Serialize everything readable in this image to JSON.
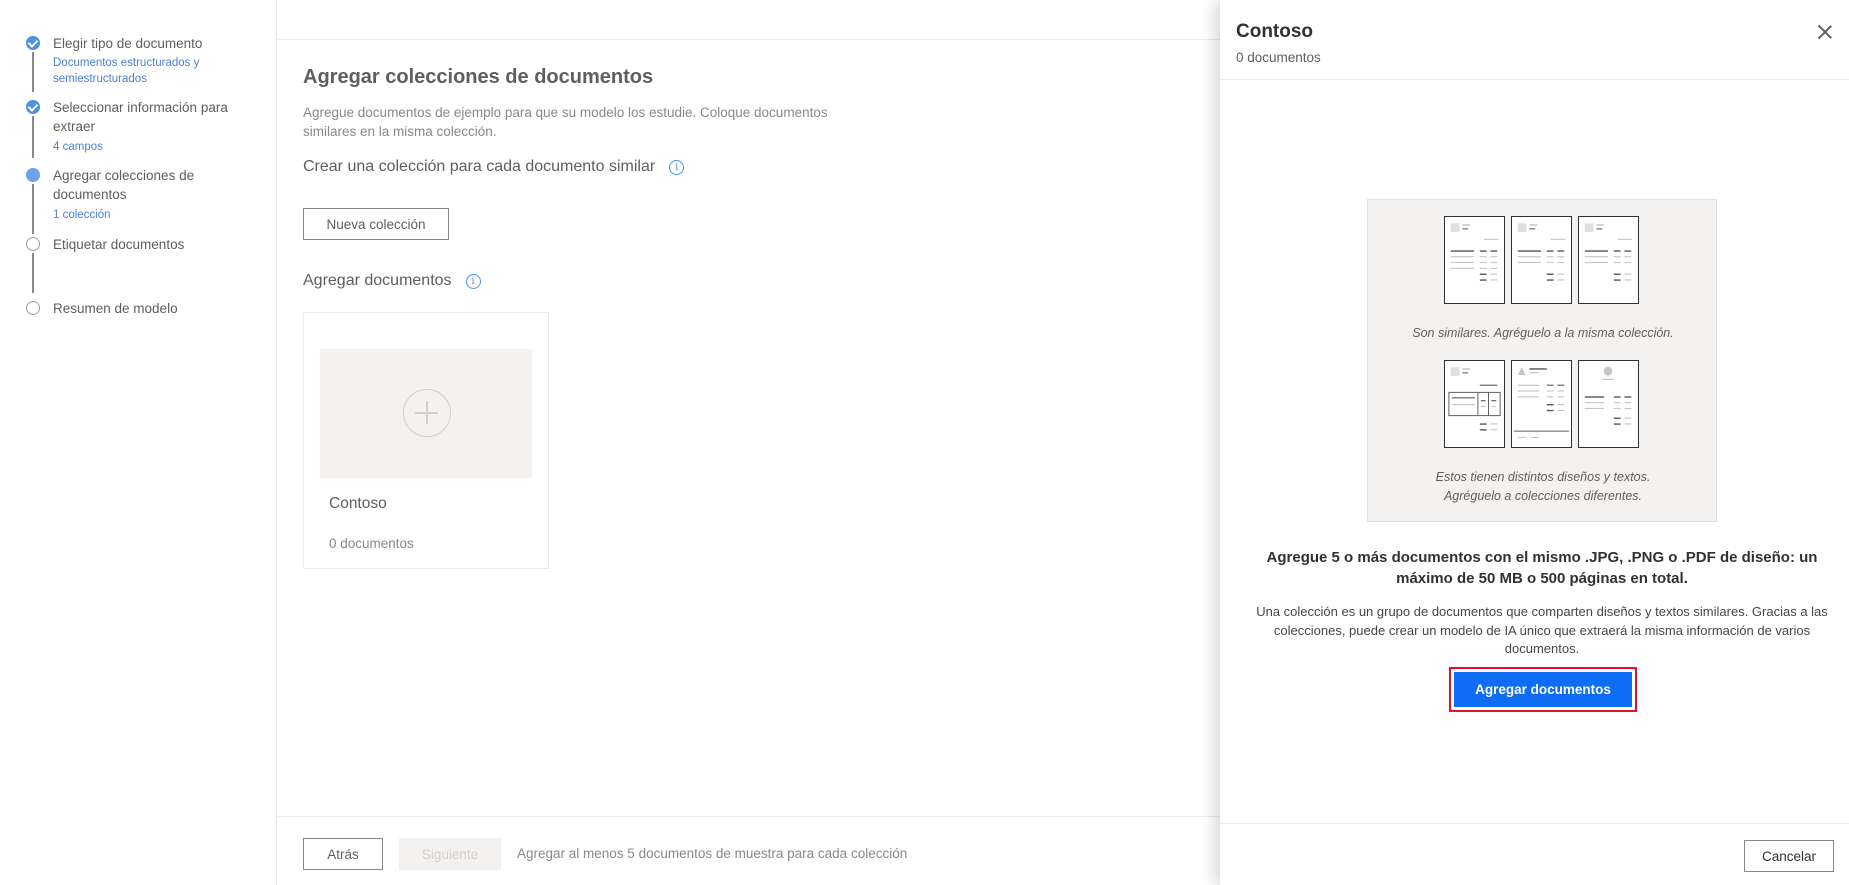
{
  "stepper": {
    "steps": [
      {
        "title": "Elegir tipo de documento",
        "subtitle": "Documentos estructurados y semiestructurados",
        "state": "done"
      },
      {
        "title": "Seleccionar información para extraer",
        "subtitle": "4 campos",
        "state": "done"
      },
      {
        "title": "Agregar colecciones de documentos",
        "subtitle": "1 colección",
        "state": "current"
      },
      {
        "title": "Etiquetar documentos",
        "subtitle": "",
        "state": "future"
      },
      {
        "title": "Resumen de modelo",
        "subtitle": "",
        "state": "future"
      }
    ]
  },
  "main": {
    "title": "Agregar colecciones de documentos",
    "description": "Agregue documentos de ejemplo para que su modelo los estudie. Coloque documentos similares en la misma colección.",
    "collection_heading": "Crear una colección para cada documento similar",
    "new_collection_label": "Nueva colección",
    "add_docs_heading": "Agregar documentos",
    "collection_card": {
      "name": "Contoso",
      "count": "0 documentos"
    }
  },
  "footer": {
    "back_label": "Atrás",
    "next_label": "Siguiente",
    "note": "Agregar al menos 5 documentos de muestra para cada colección"
  },
  "panel": {
    "title": "Contoso",
    "subtitle": "0 documentos",
    "similar_caption": "Son similares. Agréguelo a la misma colección.",
    "different_caption_1": "Estos tienen distintos diseños y textos.",
    "different_caption_2": "Agréguelo a colecciones diferentes.",
    "requirement": "Agregue 5 o más documentos con el mismo .JPG, .PNG o .PDF de diseño: un máximo de 50 MB o 500 páginas en total.",
    "explanation": "Una colección es un grupo de documentos que comparten diseños y textos similares. Gracias a las colecciones, puede crear un modelo de IA único que extraerá la misma información de varios documentos.",
    "add_documents_label": "Agregar documentos",
    "cancel_label": "Cancelar"
  },
  "colors": {
    "accent": "#0f6cf5",
    "highlight": "#e81123",
    "step_done": "#4f8fe8"
  },
  "icons": [
    "check-icon",
    "info-icon",
    "plus-icon",
    "close-icon",
    "document-icon"
  ]
}
